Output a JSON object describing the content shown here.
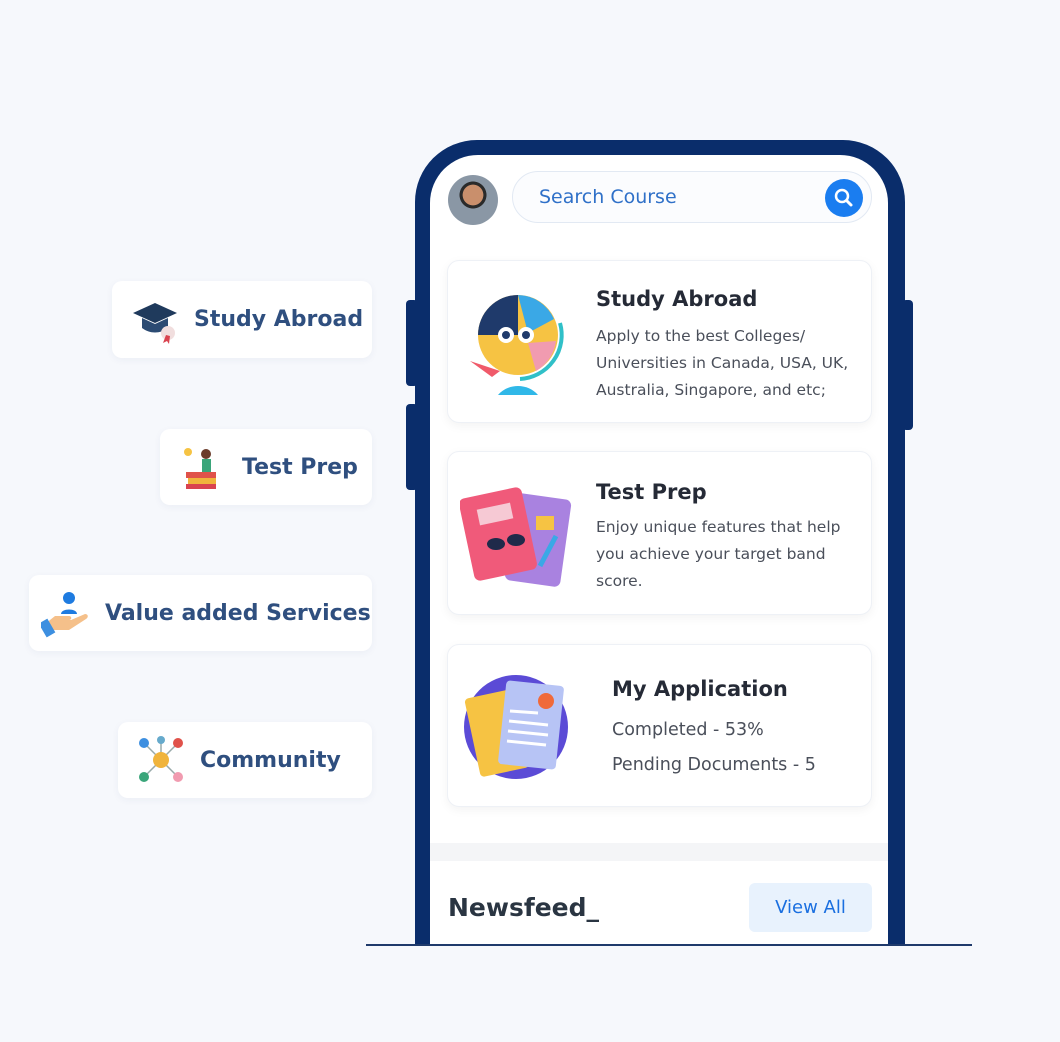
{
  "features": [
    {
      "label": "Study Abroad",
      "icon": "graduation-cap-icon"
    },
    {
      "label": "Test Prep",
      "icon": "books-reading-icon"
    },
    {
      "label": "Value added Services",
      "icon": "hand-user-icon"
    },
    {
      "label": "Community",
      "icon": "network-icon"
    }
  ],
  "search": {
    "placeholder": "Search Course",
    "icon": "search-icon"
  },
  "cards": [
    {
      "title": "Study Abroad",
      "lines": [
        "Apply to the best Colleges/",
        "Universities in Canada, USA, UK,",
        "Australia, Singapore, and etc;"
      ]
    },
    {
      "title": "Test Prep",
      "lines": [
        "Enjoy unique features that help",
        "you achieve your target band",
        "score."
      ]
    },
    {
      "title": "My Application",
      "lines": [
        "Completed - 53%",
        "Pending Documents - 5"
      ]
    }
  ],
  "newsfeed": {
    "title": "Newsfeed_",
    "view_all": "View All"
  },
  "colors": {
    "frame": "#0a2d6b",
    "accent": "#1a7df0",
    "background": "#f6f8fc"
  }
}
